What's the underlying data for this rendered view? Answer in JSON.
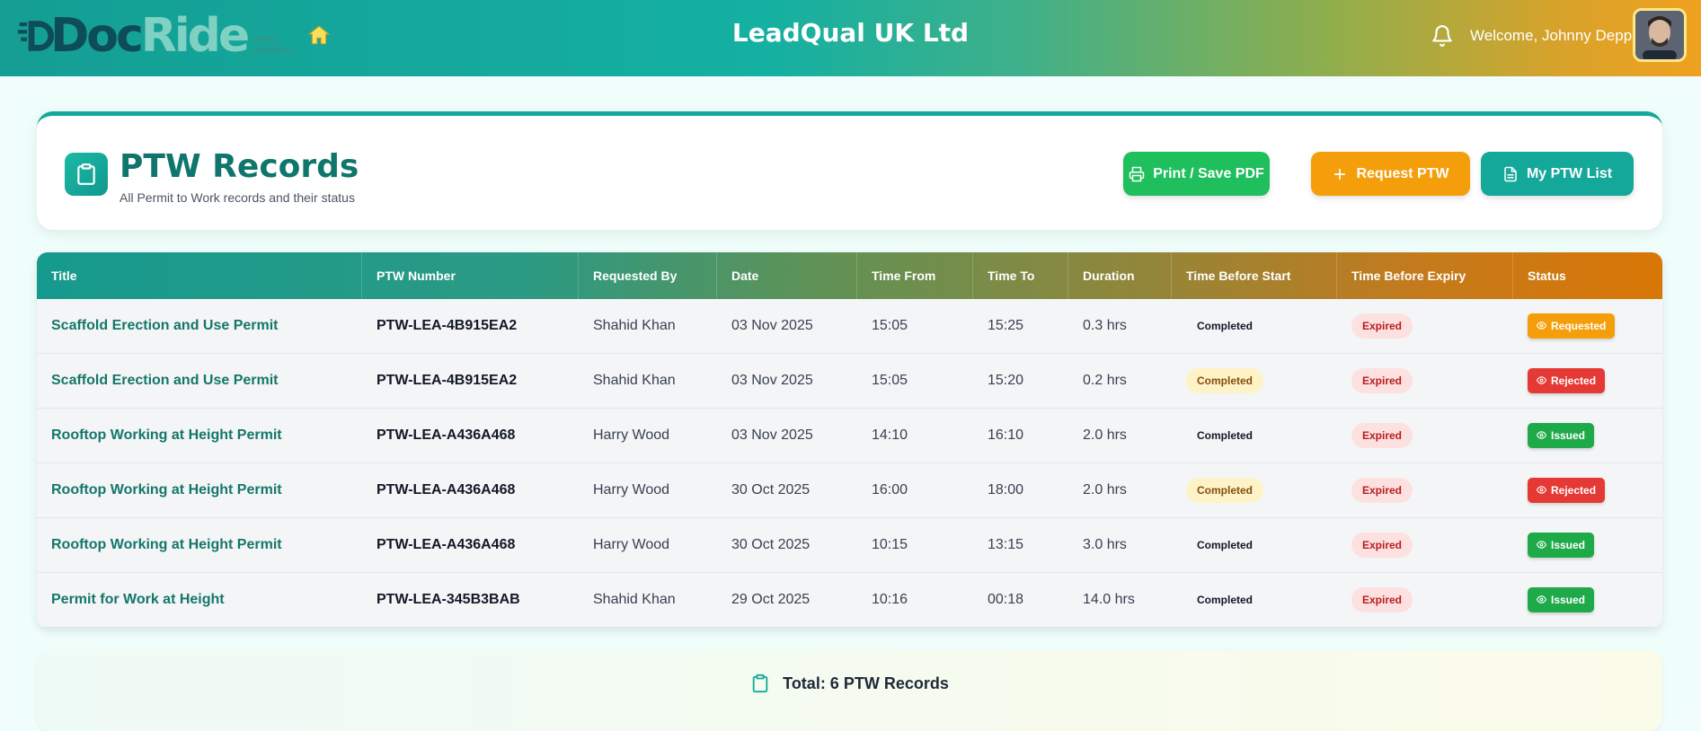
{
  "app": {
    "logo_text_dark": "Doc",
    "logo_text_light": "Ride",
    "logo_tagline_line1": "safety",
    "logo_tagline_line2": "simplified",
    "company_name": "LeadQual UK Ltd",
    "welcome_text": "Welcome, Johnny Depp"
  },
  "header": {
    "title": "PTW Records",
    "subtitle": "All Permit to Work records and their status",
    "buttons": {
      "print": "Print / Save PDF",
      "request": "Request PTW",
      "list": "My PTW List"
    }
  },
  "table": {
    "columns": [
      "Title",
      "PTW Number",
      "Requested By",
      "Date",
      "Time From",
      "Time To",
      "Duration",
      "Time Before Start",
      "Time Before Expiry",
      "Status"
    ],
    "rows": [
      {
        "title": "Scaffold Erection and Use Permit",
        "number": "PTW-LEA-4B915EA2",
        "requested_by": "Shahid Khan",
        "date": "03 Nov 2025",
        "time_from": "15:05",
        "time_to": "15:25",
        "duration": "0.3 hrs",
        "before_start": "Completed",
        "before_start_style": "plain",
        "before_expiry": "Expired",
        "status": "Requested"
      },
      {
        "title": "Scaffold Erection and Use Permit",
        "number": "PTW-LEA-4B915EA2",
        "requested_by": "Shahid Khan",
        "date": "03 Nov 2025",
        "time_from": "15:05",
        "time_to": "15:20",
        "duration": "0.2 hrs",
        "before_start": "Completed",
        "before_start_style": "yellow",
        "before_expiry": "Expired",
        "status": "Rejected"
      },
      {
        "title": "Rooftop Working at Height Permit",
        "number": "PTW-LEA-A436A468",
        "requested_by": "Harry Wood",
        "date": "03 Nov 2025",
        "time_from": "14:10",
        "time_to": "16:10",
        "duration": "2.0 hrs",
        "before_start": "Completed",
        "before_start_style": "plain",
        "before_expiry": "Expired",
        "status": "Issued"
      },
      {
        "title": "Rooftop Working at Height Permit",
        "number": "PTW-LEA-A436A468",
        "requested_by": "Harry Wood",
        "date": "30 Oct 2025",
        "time_from": "16:00",
        "time_to": "18:00",
        "duration": "2.0 hrs",
        "before_start": "Completed",
        "before_start_style": "yellow",
        "before_expiry": "Expired",
        "status": "Rejected"
      },
      {
        "title": "Rooftop Working at Height Permit",
        "number": "PTW-LEA-A436A468",
        "requested_by": "Harry Wood",
        "date": "30 Oct 2025",
        "time_from": "10:15",
        "time_to": "13:15",
        "duration": "3.0 hrs",
        "before_start": "Completed",
        "before_start_style": "plain",
        "before_expiry": "Expired",
        "status": "Issued"
      },
      {
        "title": "Permit for Work at Height",
        "number": "PTW-LEA-345B3BAB",
        "requested_by": "Shahid Khan",
        "date": "29 Oct 2025",
        "time_from": "10:16",
        "time_to": "00:18",
        "duration": "14.0 hrs",
        "before_start": "Completed",
        "before_start_style": "plain",
        "before_expiry": "Expired",
        "status": "Issued"
      }
    ]
  },
  "footer": {
    "total_text": "Total: 6 PTW Records"
  },
  "colors": {
    "teal": "#14a89a",
    "orange": "#f59e0b",
    "green": "#1fbf5d",
    "red": "#e53935"
  },
  "icons": {
    "home": "home-icon",
    "bell": "bell-icon",
    "clipboard": "clipboard-icon",
    "printer": "printer-icon",
    "plus": "plus-icon",
    "document": "document-icon",
    "eye": "eye-icon"
  }
}
